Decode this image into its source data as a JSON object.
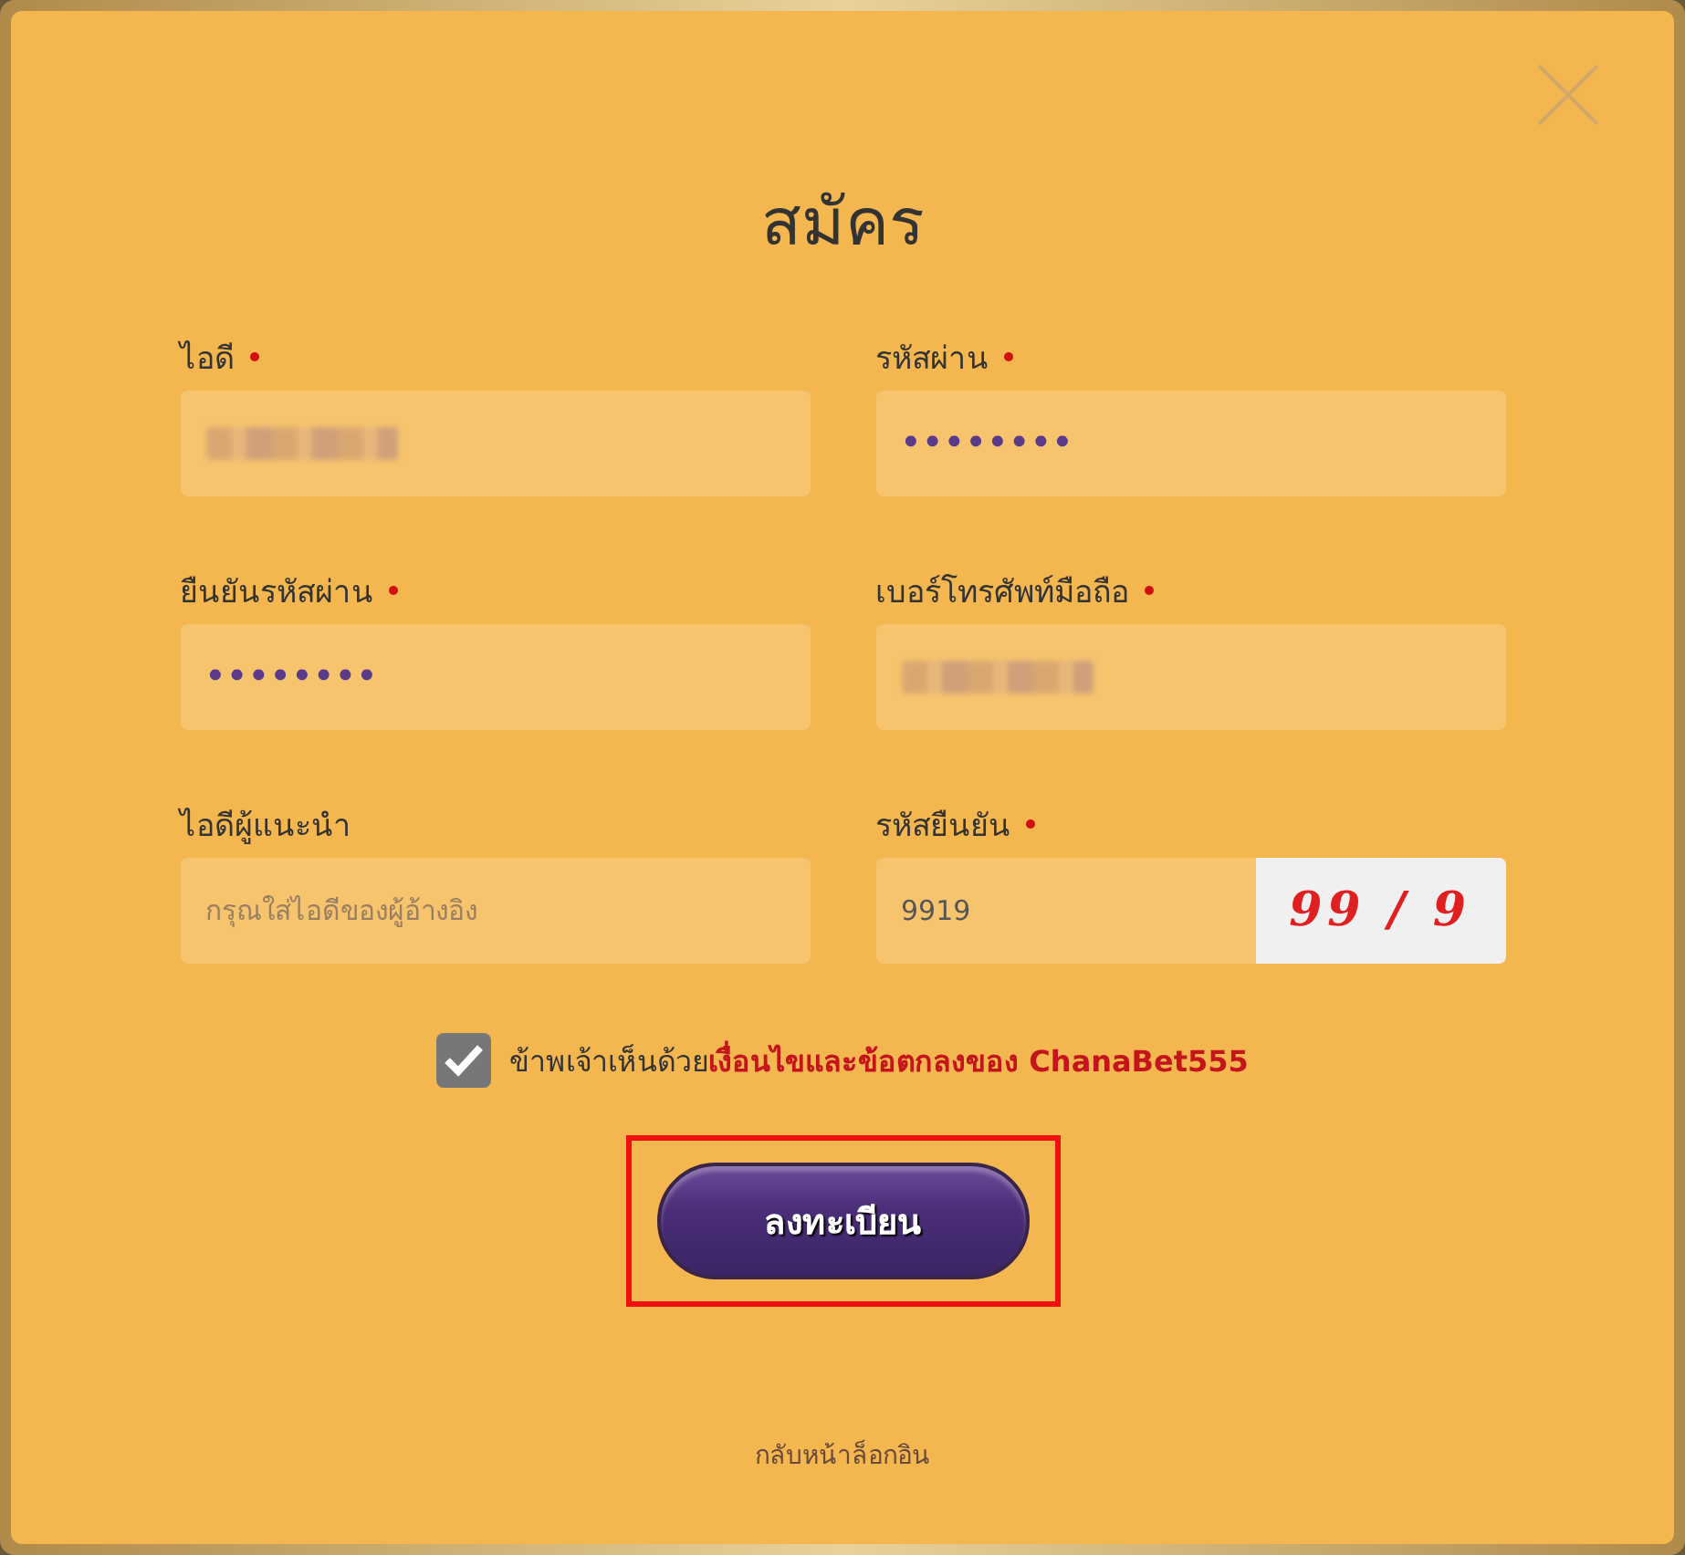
{
  "dialog": {
    "title": "สมัคร"
  },
  "fields": [
    {
      "kind": "redacted",
      "label": "ไอดี",
      "required": true
    },
    {
      "kind": "password",
      "label": "รหัสผ่าน",
      "required": true,
      "value": "••••••••"
    },
    {
      "kind": "password",
      "label": "ยืนยันรหัสผ่าน",
      "required": true,
      "value": "••••••••"
    },
    {
      "kind": "redacted",
      "label": "เบอร์โทรศัพท์มือถือ",
      "required": true
    },
    {
      "kind": "text",
      "label": "ไอดีผู้แนะนำ",
      "required": false,
      "placeholder": "กรุณใส่ไอดีของผู้อ้างอิง"
    },
    {
      "kind": "captcha",
      "label": "รหัสยืนยัน",
      "required": true,
      "value": "9919",
      "captcha": "99 / 9"
    }
  ],
  "agreement": {
    "checked": true,
    "text": "ข้าพเจ้าเห็นด้วย",
    "link": "เงื่อนไขและข้อตกลงของ ChanaBet555"
  },
  "submit": {
    "label": "ลงทะเบียน",
    "highlighted": true
  },
  "back_link": "กลับหน้าล็อกอิน"
}
